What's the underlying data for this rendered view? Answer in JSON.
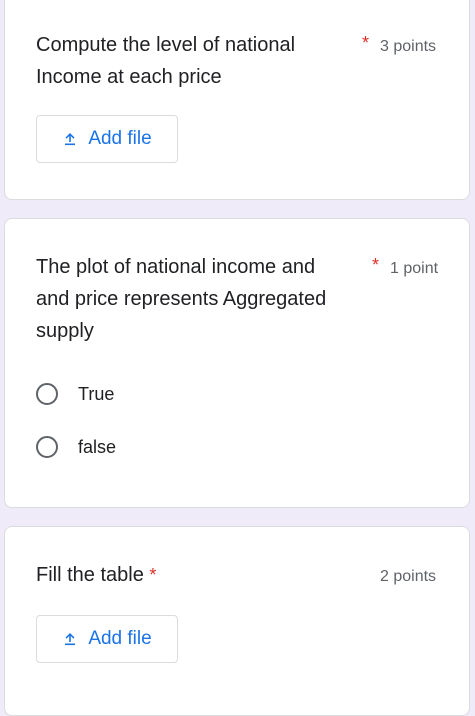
{
  "questions": [
    {
      "text_line1": "Compute the level of national",
      "text_line2": "Income at each price",
      "required_mark": "*",
      "points": "3 points",
      "add_file_label": "Add file"
    },
    {
      "text_line1": "The plot of national income and",
      "text_line2": "and price represents Aggregated",
      "text_line3": "supply",
      "required_mark": "*",
      "points": "1 point",
      "options": [
        "True",
        "false"
      ]
    },
    {
      "text": "Fill the table",
      "required_mark": "*",
      "points": "2 points",
      "add_file_label": "Add file"
    }
  ],
  "colors": {
    "background": "#f0ebf8",
    "required": "#d93025",
    "accent": "#1a73e8",
    "points_text": "#5f6368"
  },
  "icons": {
    "add_file": "upload-icon"
  }
}
